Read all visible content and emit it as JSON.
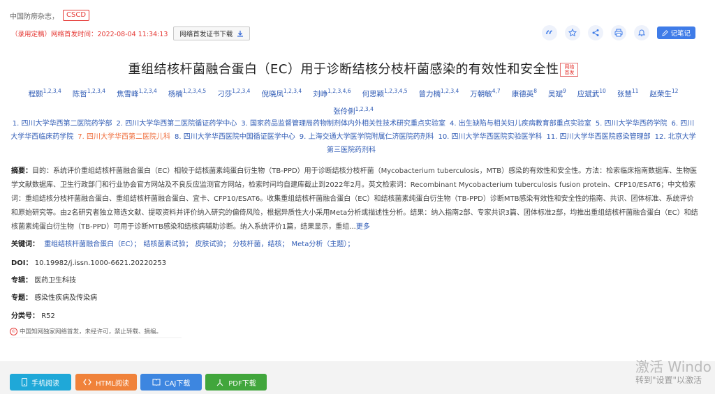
{
  "journal": {
    "name": "中国防痨杂志，",
    "badge": "CSCD"
  },
  "publish": {
    "text": "（录用定稿）网络首发时间：2022-08-04 11:34:13",
    "cert_button": "网络首发证书下载"
  },
  "toolbar": {
    "note_button": "记笔记"
  },
  "title": {
    "main": "重组结核杆菌融合蛋白（EC）用于诊断结核分枝杆菌感染的有效性和安全性",
    "badge": "网络首发"
  },
  "authors": [
    {
      "name": "程颢",
      "sup": "1,2,3,4"
    },
    {
      "name": "陈哲",
      "sup": "1,2,3,4"
    },
    {
      "name": "焦雪峰",
      "sup": "1,2,3,4"
    },
    {
      "name": "杨楠",
      "sup": "1,2,3,4,5"
    },
    {
      "name": "刁莎",
      "sup": "1,2,3,4"
    },
    {
      "name": "倪晓凤",
      "sup": "1,2,3,4"
    },
    {
      "name": "刘峥",
      "sup": "1,2,3,4,6"
    },
    {
      "name": "何思颖",
      "sup": "1,2,3,4,5"
    },
    {
      "name": "曾力楠",
      "sup": "1,2,3,4"
    },
    {
      "name": "万朝敏",
      "sup": "4,7"
    },
    {
      "name": "康德英",
      "sup": "8"
    },
    {
      "name": "吴斌",
      "sup": "9"
    },
    {
      "name": "应斌武",
      "sup": "10"
    },
    {
      "name": "张慧",
      "sup": "11"
    },
    {
      "name": "赵荣生",
      "sup": "12"
    },
    {
      "name": "张伶俐",
      "sup": "1,2,3,4"
    }
  ],
  "affiliations": [
    "1. 四川大学华西第二医院药学部",
    "2. 四川大学华西第二医院循证药学中心",
    "3. 国家药品监督管理局药物制剂体内外相关性技术研究重点实验室",
    "4. 出生缺陷与相关妇儿疾病教育部重点实验室",
    "5. 四川大学华西药学院",
    "6. 四川大学华西临床药学院",
    "7. 四川大学华西第二医院儿科",
    "8. 四川大学华西医院中国循证医学中心",
    "9. 上海交通大学医学院附属仁济医院药剂科",
    "10. 四川大学华西医院实验医学科",
    "11. 四川大学华西医院感染管理部",
    "12. 北京大学第三医院药剂科"
  ],
  "abstract": {
    "label": "摘要：",
    "text": "目的：系统评价重组结核杆菌融合蛋白（EC）相较于结核菌素纯蛋白衍生物（TB-PPD）用于诊断结核分枝杆菌（Mycobacterium tuberculosis，MTB）感染的有效性和安全性。方法：检索临床指南数据库、生物医学文献数据库、卫生行政部门和行业协会官方网站及不良反应监测官方网站，检索时间均自建库截止到2022年2月。英文检索词：Recombinant Mycobacterium tuberculosis fusion protein、CFP10/ESAT6；中文检索词：重组结核分枝杆菌融合蛋白、重组结核杆菌融合蛋白、宜卡、CFP10/ESAT6。收集重组结核杆菌融合蛋白（EC）和结核菌素纯蛋白衍生物（TB-PPD）诊断MTB感染有效性和安全性的指南、共识、团体标准、系统评价和原始研究等。由2名研究者独立筛选文献、提取资料并评价纳入研究的偏倚风险，根据异质性大小采用Meta分析或描述性分析。结果：纳入指南2部、专家共识3篇、团体标准2部，均推出重组结核杆菌融合蛋白（EC）和结核菌素纯蛋白衍生物（TB-PPD）可用于诊断MTB感染和结核病辅助诊断。纳入系统评价1篇，结果显示，重组...",
    "more": "更多"
  },
  "keywords": {
    "label": "关键词：",
    "items": [
      "重组结核杆菌融合蛋白（EC）；",
      "结核菌素试验；",
      "皮肤试验；",
      "分枝杆菌，结核；",
      "Meta分析（主题）；"
    ]
  },
  "doi": {
    "label": "DOI：",
    "value": "10.19982/j.issn.1000-6621.20220253"
  },
  "album": {
    "label": "专辑：",
    "value": "医药卫生科技"
  },
  "topic": {
    "label": "专题：",
    "value": "感染性疾病及传染病"
  },
  "classno": {
    "label": "分类号：",
    "value": "R52"
  },
  "notice": "中国知网独家网络首发，未经许可，禁止转载、摘编。",
  "downloads": [
    {
      "label": "手机阅读",
      "color": "#1fa8d8"
    },
    {
      "label": "HTML阅读",
      "color": "#f0823a"
    },
    {
      "label": "CAJ下载",
      "color": "#3d86e0"
    },
    {
      "label": "PDF下载",
      "color": "#41a63c"
    }
  ],
  "watermark": {
    "line1": "激活 Windo",
    "line2": "转到\"设置\"以激活"
  }
}
